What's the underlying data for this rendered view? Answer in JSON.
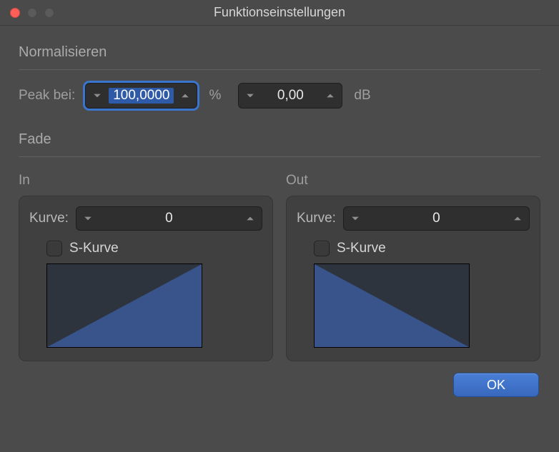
{
  "window": {
    "title": "Funktionseinstellungen"
  },
  "normalize": {
    "header": "Normalisieren",
    "peak_label": "Peak bei:",
    "percent_value": "100,0000",
    "percent_unit": "%",
    "db_value": "0,00",
    "db_unit": "dB"
  },
  "fade": {
    "header": "Fade",
    "in": {
      "sub_label": "In",
      "curve_label": "Kurve:",
      "curve_value": "0",
      "s_curve_label": "S-Kurve",
      "s_curve_checked": false
    },
    "out": {
      "sub_label": "Out",
      "curve_label": "Kurve:",
      "curve_value": "0",
      "s_curve_label": "S-Kurve",
      "s_curve_checked": false
    }
  },
  "buttons": {
    "ok": "OK"
  },
  "colors": {
    "accent": "#3a76cf",
    "curve_fill": "#39548a",
    "curve_bg": "#2d343d"
  }
}
